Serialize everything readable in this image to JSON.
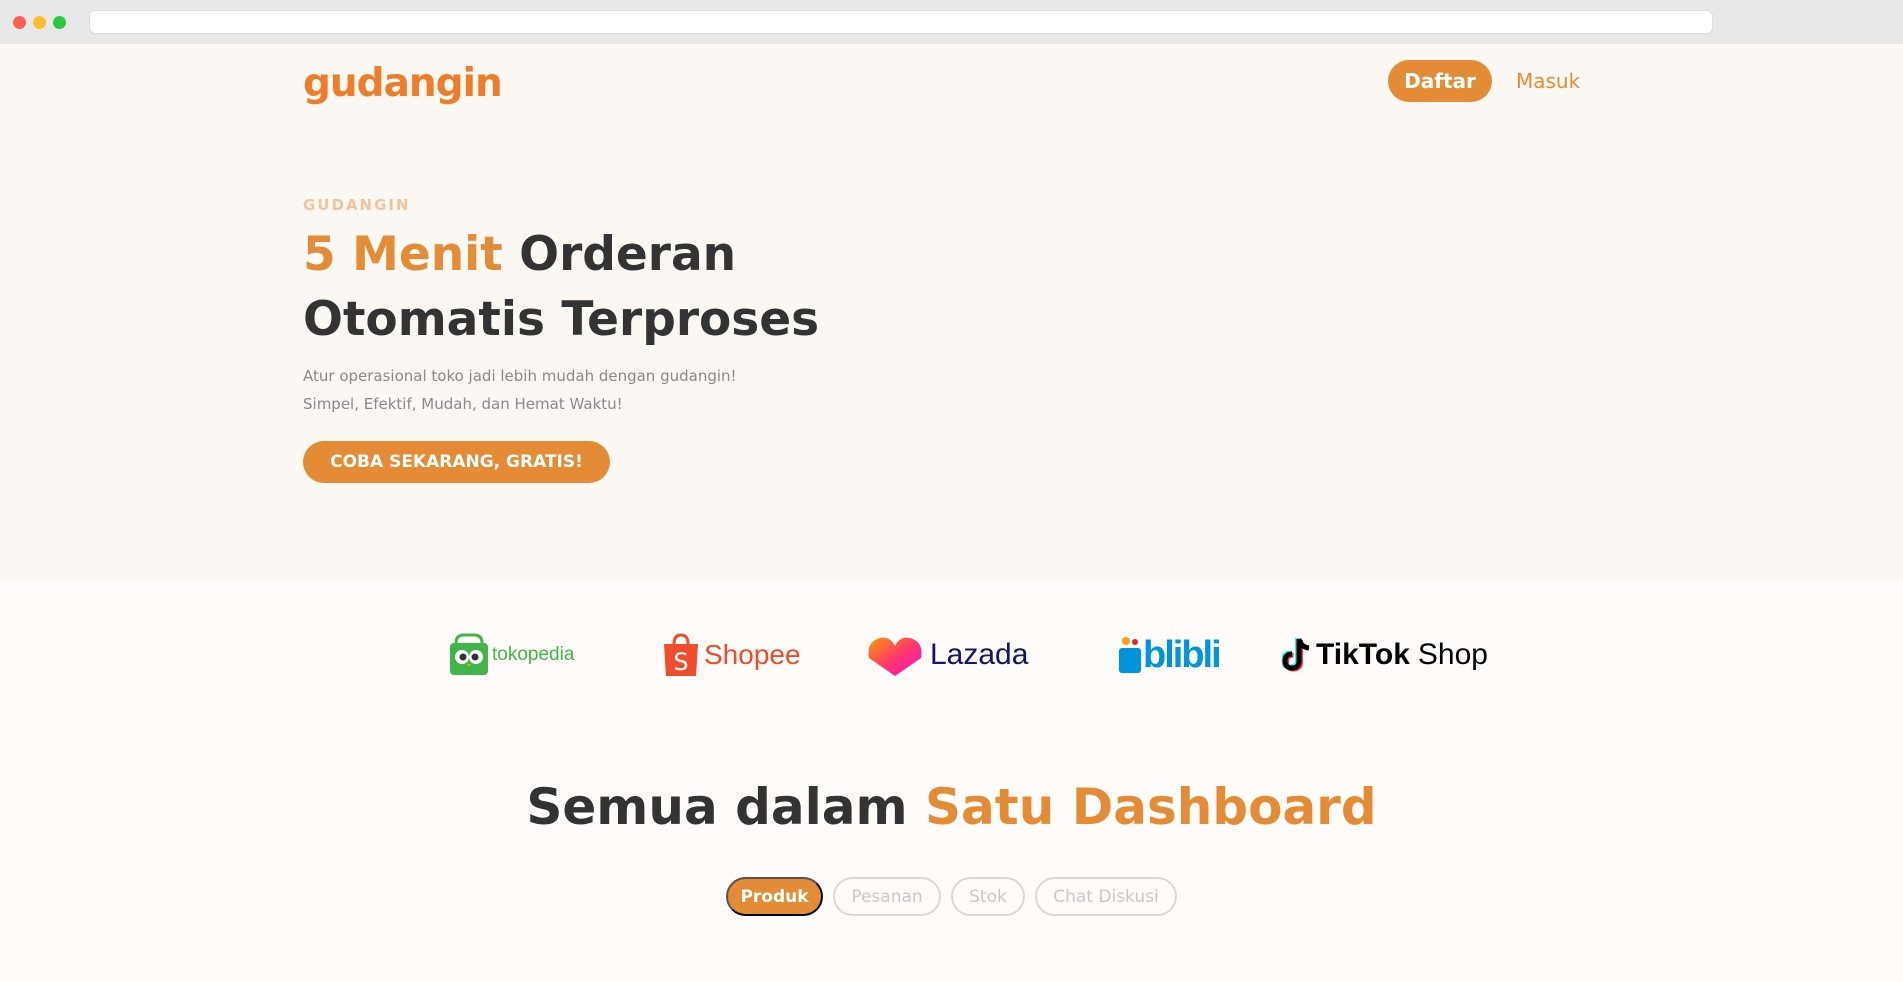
{
  "brand": {
    "logo_text": "gudangin",
    "accent_color": "#e38b35",
    "logo_color": "#ee7d2a"
  },
  "nav": {
    "register_label": "Daftar",
    "login_label": "Masuk"
  },
  "hero": {
    "eyebrow": "GUDANGIN",
    "headline_accent": "5 Menit",
    "headline_rest": " Orderan Otomatis Terproses",
    "subtext_line1": "Atur operasional toko jadi lebih mudah dengan gudangin!",
    "subtext_line2": "Simpel, Efektif, Mudah, dan Hemat Waktu!",
    "cta_label": "COBA SEKARANG, GRATIS!"
  },
  "partners": [
    {
      "name": "tokopedia",
      "icon": "tokopedia-logo",
      "color": "#42b549"
    },
    {
      "name": "Shopee",
      "icon": "shopee-logo",
      "color": "#ee4d2d"
    },
    {
      "name": "Lazada",
      "icon": "lazada-logo",
      "color": "#0f146d"
    },
    {
      "name": "blibli",
      "icon": "blibli-logo",
      "color": "#0095da"
    },
    {
      "name": "TikTok",
      "suffix": "Shop",
      "icon": "tiktok-shop-logo",
      "color": "#000000"
    }
  ],
  "features": {
    "title_plain": "Semua dalam ",
    "title_accent": "Satu Dashboard",
    "tabs": [
      {
        "label": "Produk",
        "active": true
      },
      {
        "label": "Pesanan",
        "active": false
      },
      {
        "label": "Stok",
        "active": false
      },
      {
        "label": "Chat Diskusi",
        "active": false
      }
    ]
  }
}
